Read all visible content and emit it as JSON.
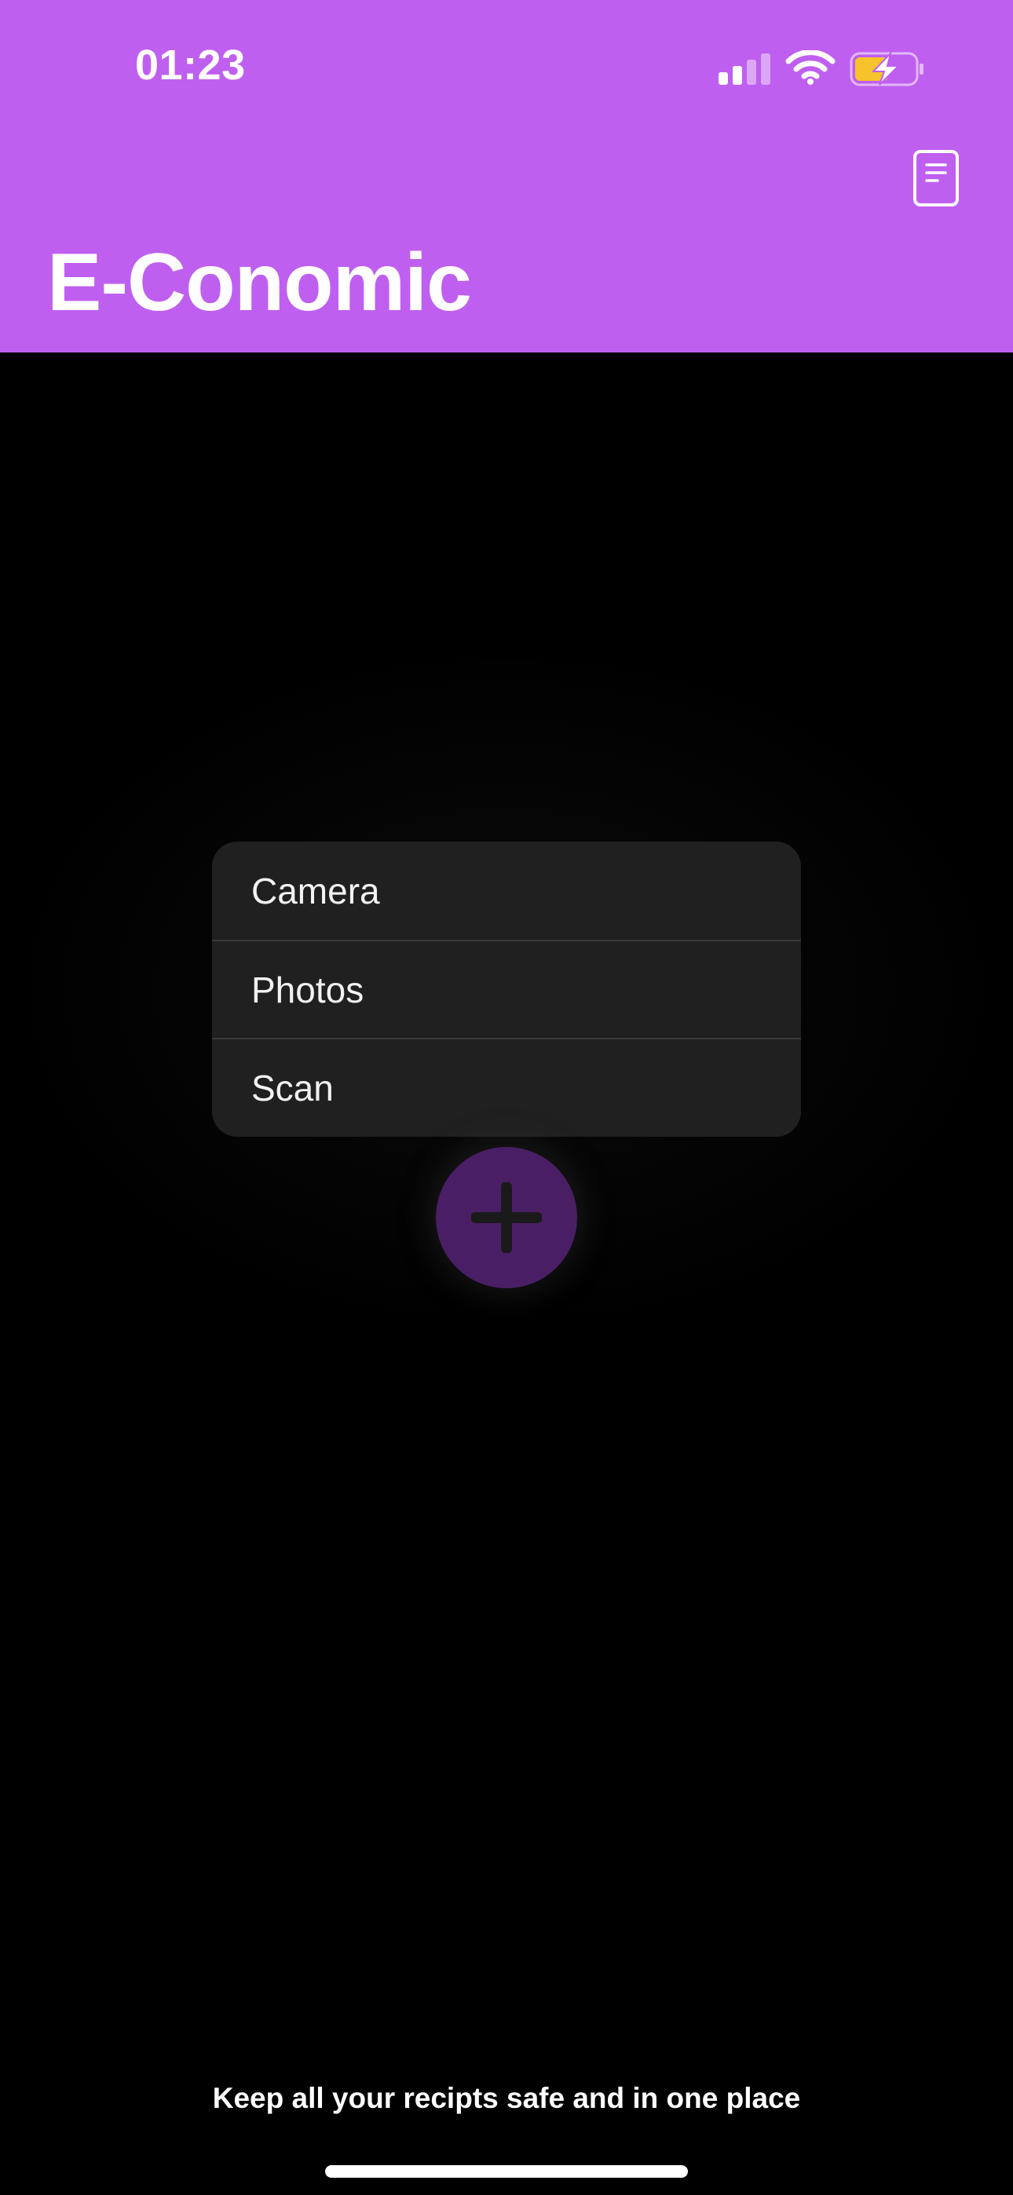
{
  "status_bar": {
    "time": "01:23",
    "icons": [
      "signal-icon",
      "wifi-icon",
      "battery-charging-icon"
    ]
  },
  "header": {
    "title": "E-Conomic",
    "action_icon": "document-icon",
    "background_color": "#BF5FF0"
  },
  "menu": {
    "items": [
      {
        "label": "Camera"
      },
      {
        "label": "Photos"
      },
      {
        "label": "Scan"
      }
    ]
  },
  "fab": {
    "icon": "plus-icon",
    "color": "#4A1E64"
  },
  "footer": {
    "tagline": "Keep all your recipts safe and in one place"
  },
  "colors": {
    "accent": "#BF5FF0",
    "background": "#000000",
    "menu_bg": "#202020",
    "battery_fill": "#F6C32B"
  }
}
